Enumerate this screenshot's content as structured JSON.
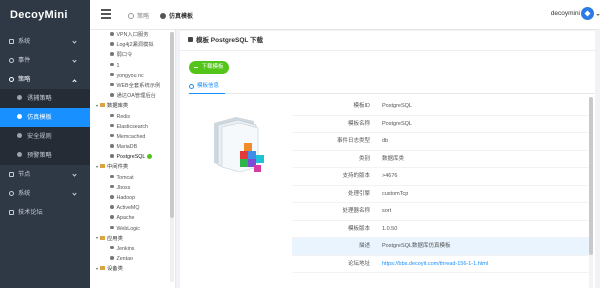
{
  "app": {
    "logo": "DecoyMini"
  },
  "breadcrumb": {
    "parent": "策略",
    "current": "仿真模板"
  },
  "user": {
    "name": "decoymini"
  },
  "nav": {
    "items": [
      {
        "label": "系统"
      },
      {
        "label": "事件"
      },
      {
        "label": "策略"
      }
    ],
    "sub": [
      {
        "label": "诱捕策略"
      },
      {
        "label": "仿真模板"
      },
      {
        "label": "安全规则"
      },
      {
        "label": "预警策略"
      }
    ],
    "bottom": [
      {
        "label": "节点"
      },
      {
        "label": "系统"
      },
      {
        "label": "技术论坛"
      }
    ]
  },
  "tree": {
    "rows": [
      {
        "type": "leaf",
        "label": "VPN入口服务"
      },
      {
        "type": "leaf",
        "label": "Log4j2漏洞模拟"
      },
      {
        "type": "leaf",
        "label": "弱口令"
      },
      {
        "type": "leaf",
        "label": "1"
      },
      {
        "type": "leaf",
        "label": "yongyou nc"
      },
      {
        "type": "leaf",
        "label": "WEB全套系统示例"
      },
      {
        "type": "leaf",
        "label": "通达OA管理后台"
      },
      {
        "type": "group",
        "label": "数据库类"
      },
      {
        "type": "leaf",
        "label": "Redis"
      },
      {
        "type": "leaf",
        "label": "Elasticsearch"
      },
      {
        "type": "leaf",
        "label": "Memcached"
      },
      {
        "type": "leaf",
        "label": "MariaDB"
      },
      {
        "type": "leaf",
        "label": "PostgreSQL",
        "selected": true
      },
      {
        "type": "group",
        "label": "中间件类"
      },
      {
        "type": "leaf",
        "label": "Tomcat"
      },
      {
        "type": "leaf",
        "label": "Jboss"
      },
      {
        "type": "leaf",
        "label": "Hadoop"
      },
      {
        "type": "leaf",
        "label": "ActiveMQ"
      },
      {
        "type": "leaf",
        "label": "Apache"
      },
      {
        "type": "leaf",
        "label": "WebLogic"
      },
      {
        "type": "group",
        "label": "应用类"
      },
      {
        "type": "leaf",
        "label": "Jenkins"
      },
      {
        "type": "leaf",
        "label": "Zentao"
      },
      {
        "type": "group",
        "label": "设备类"
      }
    ]
  },
  "card": {
    "title": "模板 PostgreSQL 下载",
    "download_label": "下载模板",
    "tab_label": "模板信息"
  },
  "info": {
    "rows": [
      {
        "key": "模板ID",
        "value": "PostgreSQL"
      },
      {
        "key": "模板名称",
        "value": "PostgreSQL"
      },
      {
        "key": "事件日志类型",
        "value": "db"
      },
      {
        "key": "类别",
        "value": "数据库类"
      },
      {
        "key": "支持的版本",
        "value": ">4676"
      },
      {
        "key": "处理引擎",
        "value": "customTcp"
      },
      {
        "key": "处理器名称",
        "value": "sort"
      },
      {
        "key": "模板版本",
        "value": "1.0.50"
      },
      {
        "key": "描述",
        "value": "PostgreSQL数据库仿真模板",
        "highlight": true
      },
      {
        "key": "论坛地址",
        "value": "https://bbs.decoyit.com/thread-156-1-1.html",
        "link": true
      }
    ]
  },
  "colors": {
    "sidebar": "#2f3845",
    "accent": "#1890ff",
    "download": "#52c41a"
  }
}
